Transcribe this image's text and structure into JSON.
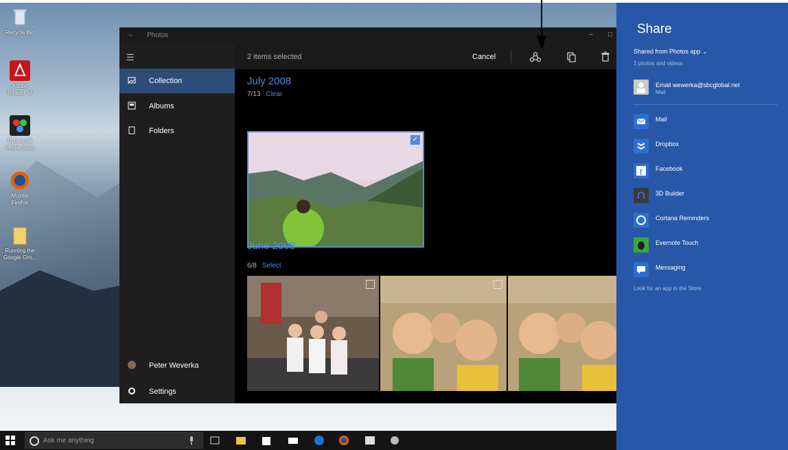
{
  "desktop": {
    "icons": [
      {
        "label": "Recycle Bin",
        "icon": "recycle-bin-icon"
      },
      {
        "label": "Adobe Reader XI",
        "icon": "adobe-reader-icon"
      },
      {
        "label": "CyberLink Media Suite",
        "icon": "cyberlink-icon"
      },
      {
        "label": "Mozilla Firefox",
        "icon": "firefox-icon"
      },
      {
        "label": "Running the Google Gro...",
        "icon": "folder-icon"
      }
    ]
  },
  "photos_app": {
    "window_title": "Photos",
    "nav": {
      "items": [
        {
          "label": "Collection",
          "icon": "image-icon",
          "active": true
        },
        {
          "label": "Albums",
          "icon": "album-icon"
        },
        {
          "label": "Folders",
          "icon": "folder-icon"
        }
      ],
      "user": "Peter Weverka",
      "settings": "Settings"
    },
    "command_bar": {
      "selection_text": "2 items selected",
      "cancel_label": "Cancel",
      "share_icon": "share-icon",
      "copy_icon": "copy-icon",
      "delete_icon": "trash-icon"
    },
    "groups": [
      {
        "month": "July 2008",
        "date": "7/13",
        "action": "Clear"
      },
      {
        "month": "June 2008",
        "date": "6/8",
        "action": "Select"
      }
    ]
  },
  "share_pane": {
    "title": "Share",
    "shared_from": "Shared from Photos app",
    "subtitle": "2 photos and videos",
    "contact": {
      "label": "Email wewerka@sbcglobal.net",
      "sub": "Mail"
    },
    "apps": [
      {
        "label": "Mail",
        "icon": "mail-icon",
        "color": "#2f6ed0"
      },
      {
        "label": "Dropbox",
        "icon": "dropbox-icon",
        "color": "#2f6ed0"
      },
      {
        "label": "Facebook",
        "icon": "facebook-icon",
        "color": "#2f6ed0"
      },
      {
        "label": "3D Builder",
        "icon": "3d-builder-icon",
        "color": "#3b3b3b"
      },
      {
        "label": "Cortana Reminders",
        "icon": "cortana-icon",
        "color": "#2f6ed0"
      },
      {
        "label": "Evernote Touch",
        "icon": "evernote-icon",
        "color": "#3aa63a"
      },
      {
        "label": "Messaging",
        "icon": "messaging-icon",
        "color": "#2f6ed0"
      }
    ],
    "store_link": "Look for an app in the Store"
  },
  "taskbar": {
    "search_placeholder": "Ask me anything",
    "icons": [
      "task-view-icon",
      "file-explorer-icon",
      "store-icon",
      "mail-icon",
      "edge-icon",
      "firefox-icon",
      "photos-icon",
      "app-icon"
    ]
  }
}
